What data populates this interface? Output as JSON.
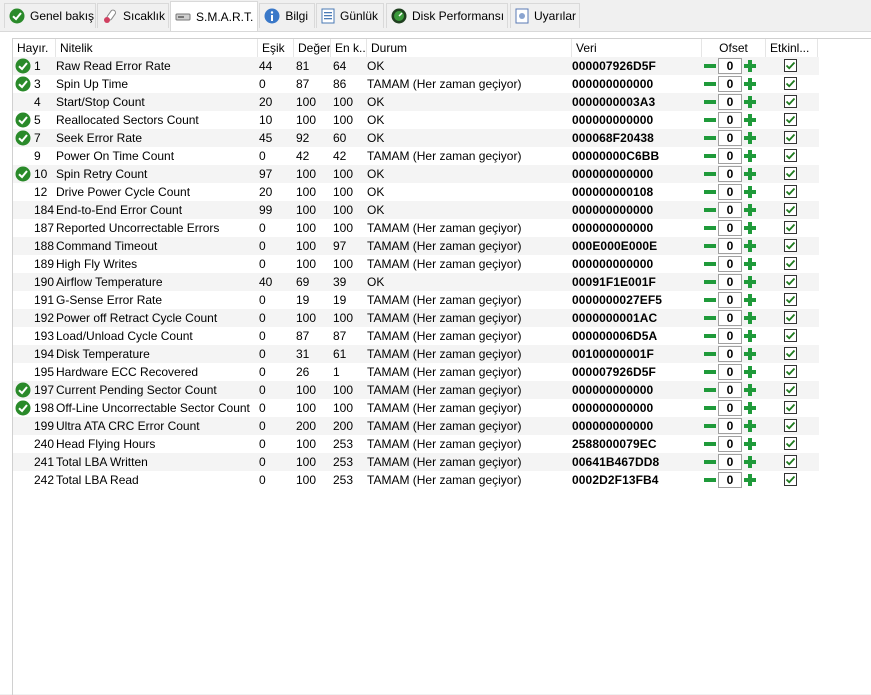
{
  "tabs": [
    {
      "label": "Genel bakış",
      "icon": "check-circle-icon"
    },
    {
      "label": "Sıcaklık",
      "icon": "thermometer-icon"
    },
    {
      "label": "S.M.A.R.T.",
      "icon": "smart-drive-icon"
    },
    {
      "label": "Bilgi",
      "icon": "info-icon"
    },
    {
      "label": "Günlük",
      "icon": "log-icon"
    },
    {
      "label": "Disk Performansı",
      "icon": "gauge-icon"
    },
    {
      "label": "Uyarılar",
      "icon": "alerts-icon"
    }
  ],
  "active_tab": "S.M.A.R.T.",
  "columns": {
    "id": "Hayır.",
    "name": "Nitelik",
    "threshold": "Eşik",
    "value": "Değer",
    "worst": "En k...",
    "status": "Durum",
    "raw": "Veri",
    "offset": "Ofset",
    "enabled": "Etkinl..."
  },
  "colors": {
    "ok_green": "#2a8a2a",
    "stepper_green": "#1f9a3a"
  },
  "rows": [
    {
      "ok": true,
      "id": "1",
      "name": "Raw Read Error Rate",
      "thr": "44",
      "val": "81",
      "wor": "64",
      "status": "OK",
      "raw": "000007926D5F",
      "offset": "0",
      "enabled": true
    },
    {
      "ok": true,
      "id": "3",
      "name": "Spin Up Time",
      "thr": "0",
      "val": "87",
      "wor": "86",
      "status": "TAMAM (Her zaman geçiyor)",
      "raw": "000000000000",
      "offset": "0",
      "enabled": true
    },
    {
      "ok": false,
      "id": "4",
      "name": "Start/Stop Count",
      "thr": "20",
      "val": "100",
      "wor": "100",
      "status": "OK",
      "raw": "0000000003A3",
      "offset": "0",
      "enabled": true
    },
    {
      "ok": true,
      "id": "5",
      "name": "Reallocated Sectors Count",
      "thr": "10",
      "val": "100",
      "wor": "100",
      "status": "OK",
      "raw": "000000000000",
      "offset": "0",
      "enabled": true
    },
    {
      "ok": true,
      "id": "7",
      "name": "Seek Error Rate",
      "thr": "45",
      "val": "92",
      "wor": "60",
      "status": "OK",
      "raw": "000068F20438",
      "offset": "0",
      "enabled": true
    },
    {
      "ok": false,
      "id": "9",
      "name": "Power On Time Count",
      "thr": "0",
      "val": "42",
      "wor": "42",
      "status": "TAMAM (Her zaman geçiyor)",
      "raw": "00000000C6BB",
      "offset": "0",
      "enabled": true
    },
    {
      "ok": true,
      "id": "10",
      "name": "Spin Retry Count",
      "thr": "97",
      "val": "100",
      "wor": "100",
      "status": "OK",
      "raw": "000000000000",
      "offset": "0",
      "enabled": true
    },
    {
      "ok": false,
      "id": "12",
      "name": "Drive Power Cycle Count",
      "thr": "20",
      "val": "100",
      "wor": "100",
      "status": "OK",
      "raw": "000000000108",
      "offset": "0",
      "enabled": true
    },
    {
      "ok": false,
      "id": "184",
      "name": "End-to-End Error Count",
      "thr": "99",
      "val": "100",
      "wor": "100",
      "status": "OK",
      "raw": "000000000000",
      "offset": "0",
      "enabled": true
    },
    {
      "ok": false,
      "id": "187",
      "name": "Reported Uncorrectable Errors",
      "thr": "0",
      "val": "100",
      "wor": "100",
      "status": "TAMAM (Her zaman geçiyor)",
      "raw": "000000000000",
      "offset": "0",
      "enabled": true
    },
    {
      "ok": false,
      "id": "188",
      "name": "Command Timeout",
      "thr": "0",
      "val": "100",
      "wor": "97",
      "status": "TAMAM (Her zaman geçiyor)",
      "raw": "000E000E000E",
      "offset": "0",
      "enabled": true
    },
    {
      "ok": false,
      "id": "189",
      "name": "High Fly Writes",
      "thr": "0",
      "val": "100",
      "wor": "100",
      "status": "TAMAM (Her zaman geçiyor)",
      "raw": "000000000000",
      "offset": "0",
      "enabled": true
    },
    {
      "ok": false,
      "id": "190",
      "name": "Airflow Temperature",
      "thr": "40",
      "val": "69",
      "wor": "39",
      "status": "OK",
      "raw": "00091F1E001F",
      "offset": "0",
      "enabled": true
    },
    {
      "ok": false,
      "id": "191",
      "name": "G-Sense Error Rate",
      "thr": "0",
      "val": "19",
      "wor": "19",
      "status": "TAMAM (Her zaman geçiyor)",
      "raw": "0000000027EF5",
      "offset": "0",
      "enabled": true
    },
    {
      "ok": false,
      "id": "192",
      "name": "Power off Retract Cycle Count",
      "thr": "0",
      "val": "100",
      "wor": "100",
      "status": "TAMAM (Her zaman geçiyor)",
      "raw": "0000000001AC",
      "offset": "0",
      "enabled": true
    },
    {
      "ok": false,
      "id": "193",
      "name": "Load/Unload Cycle Count",
      "thr": "0",
      "val": "87",
      "wor": "87",
      "status": "TAMAM (Her zaman geçiyor)",
      "raw": "000000006D5A",
      "offset": "0",
      "enabled": true
    },
    {
      "ok": false,
      "id": "194",
      "name": "Disk Temperature",
      "thr": "0",
      "val": "31",
      "wor": "61",
      "status": "TAMAM (Her zaman geçiyor)",
      "raw": "00100000001F",
      "offset": "0",
      "enabled": true
    },
    {
      "ok": false,
      "id": "195",
      "name": "Hardware ECC Recovered",
      "thr": "0",
      "val": "26",
      "wor": "1",
      "status": "TAMAM (Her zaman geçiyor)",
      "raw": "000007926D5F",
      "offset": "0",
      "enabled": true
    },
    {
      "ok": true,
      "id": "197",
      "name": "Current Pending Sector Count",
      "thr": "0",
      "val": "100",
      "wor": "100",
      "status": "TAMAM (Her zaman geçiyor)",
      "raw": "000000000000",
      "offset": "0",
      "enabled": true
    },
    {
      "ok": true,
      "id": "198",
      "name": "Off-Line Uncorrectable Sector Count",
      "thr": "0",
      "val": "100",
      "wor": "100",
      "status": "TAMAM (Her zaman geçiyor)",
      "raw": "000000000000",
      "offset": "0",
      "enabled": true
    },
    {
      "ok": false,
      "id": "199",
      "name": "Ultra ATA CRC Error Count",
      "thr": "0",
      "val": "200",
      "wor": "200",
      "status": "TAMAM (Her zaman geçiyor)",
      "raw": "000000000000",
      "offset": "0",
      "enabled": true
    },
    {
      "ok": false,
      "id": "240",
      "name": "Head Flying Hours",
      "thr": "0",
      "val": "100",
      "wor": "253",
      "status": "TAMAM (Her zaman geçiyor)",
      "raw": "2588000079EC",
      "offset": "0",
      "enabled": true
    },
    {
      "ok": false,
      "id": "241",
      "name": "Total LBA Written",
      "thr": "0",
      "val": "100",
      "wor": "253",
      "status": "TAMAM (Her zaman geçiyor)",
      "raw": "00641B467DD8",
      "offset": "0",
      "enabled": true
    },
    {
      "ok": false,
      "id": "242",
      "name": "Total LBA Read",
      "thr": "0",
      "val": "100",
      "wor": "253",
      "status": "TAMAM (Her zaman geçiyor)",
      "raw": "0002D2F13FB4",
      "offset": "0",
      "enabled": true
    }
  ]
}
